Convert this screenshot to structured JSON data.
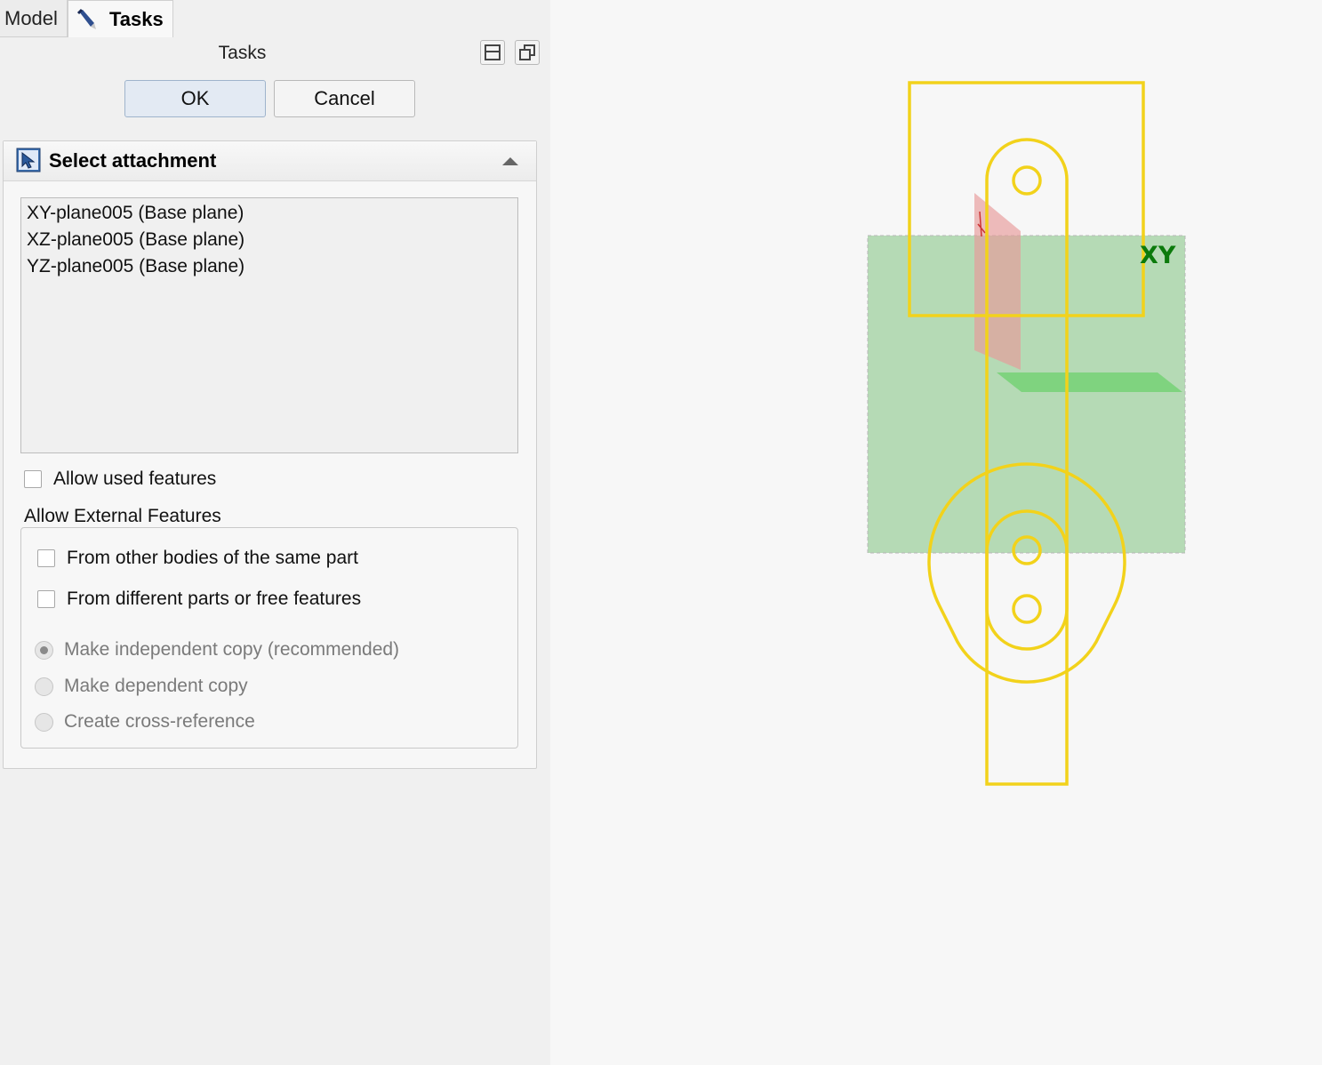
{
  "tabs": {
    "model": "Model",
    "tasks": "Tasks"
  },
  "panel": {
    "title": "Tasks",
    "ok": "OK",
    "cancel": "Cancel"
  },
  "attachment": {
    "header": "Select attachment",
    "items": [
      "XY-plane005 (Base plane)",
      "XZ-plane005 (Base plane)",
      "YZ-plane005 (Base plane)"
    ],
    "allow_used": "Allow used features",
    "external_title": "Allow External Features",
    "other_bodies": "From other bodies of the same part",
    "different_parts": "From different parts or free features",
    "radio_independent": "Make independent copy (recommended)",
    "radio_dependent": "Make dependent copy",
    "radio_cross": "Create cross-reference"
  },
  "viewport": {
    "plane_label": "XY"
  },
  "colors": {
    "sketch": "#f2d21b",
    "xy_plane": "#9bcf9b",
    "xz_plane": "#62d062",
    "yz_plane": "#e89a9a",
    "label": "#0b7a0b"
  }
}
